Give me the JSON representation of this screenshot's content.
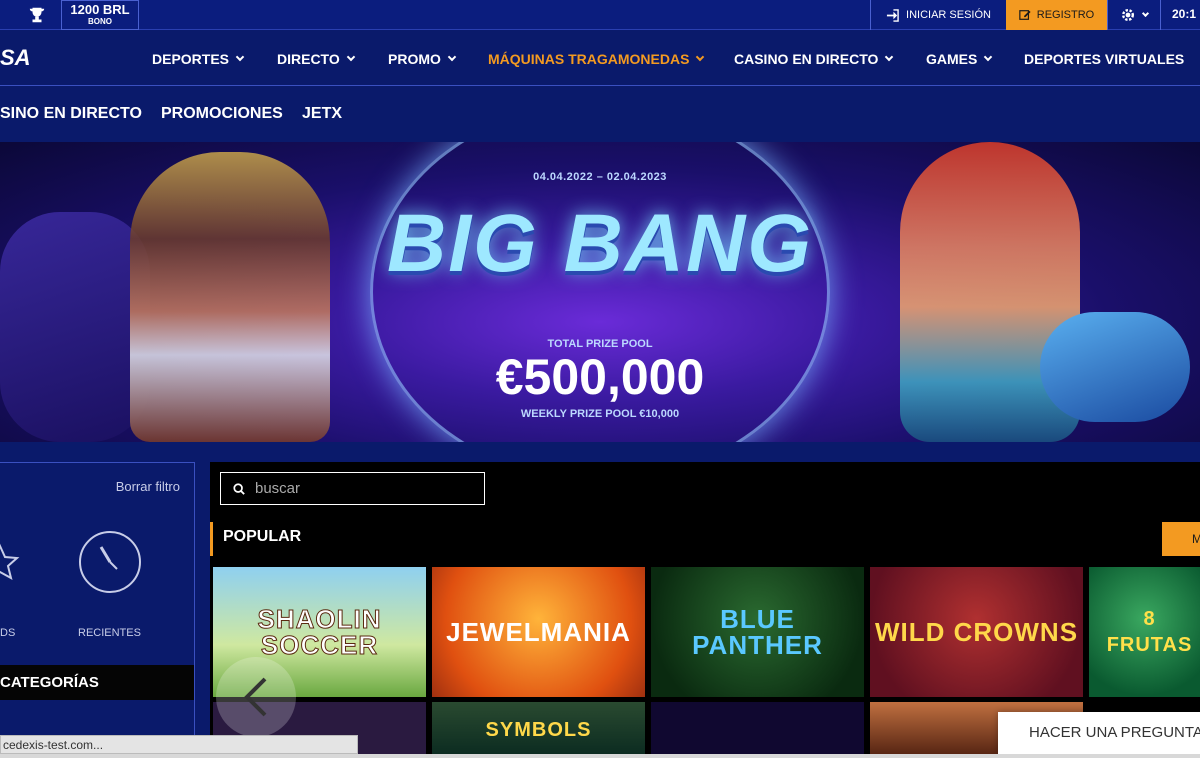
{
  "topbar": {
    "bonus_amount": "1200 BRL",
    "bonus_label": "BONO",
    "login_label": "INICIAR SESIÓN",
    "register_label": "REGISTRO",
    "clock": "20:1"
  },
  "nav": {
    "logo": "SA",
    "items": [
      {
        "label": "DEPORTES"
      },
      {
        "label": "DIRECTO"
      },
      {
        "label": "PROMO"
      },
      {
        "label": "MÁQUINAS TRAGAMONEDAS",
        "active": true
      },
      {
        "label": "CASINO EN DIRECTO"
      },
      {
        "label": "GAMES"
      },
      {
        "label": "DEPORTES VIRTUALES"
      }
    ]
  },
  "subnav": {
    "items": [
      "SINO EN DIRECTO",
      "PROMOCIONES",
      "JETX"
    ]
  },
  "banner": {
    "dates": "04.04.2022 – 02.04.2023",
    "title": "BIG BANG",
    "pool_label": "TOTAL PRIZE POOL",
    "pool": "€500,000",
    "weekly": "WEEKLY PRIZE POOL €10,000"
  },
  "sidebar": {
    "clear_filter": "Borrar filtro",
    "favorites_label": "DS",
    "recent_label": "RECIENTES",
    "categories_label": "CATEGORÍAS"
  },
  "main": {
    "search_placeholder": "buscar",
    "section_title": "POPULAR",
    "more_label": "M",
    "games": [
      {
        "name": "SHAOLIN SOCCER"
      },
      {
        "name": "JEWELMANIA"
      },
      {
        "name": "BLUE PANTHER"
      },
      {
        "name": "WILD CROWNS"
      },
      {
        "name": "8 FRUTAS"
      }
    ],
    "row2": [
      "",
      "SYMBOLS",
      "",
      ""
    ]
  },
  "chat": {
    "label": "HACER UNA PREGUNTA"
  },
  "status_url": "cedexis-test.com..."
}
